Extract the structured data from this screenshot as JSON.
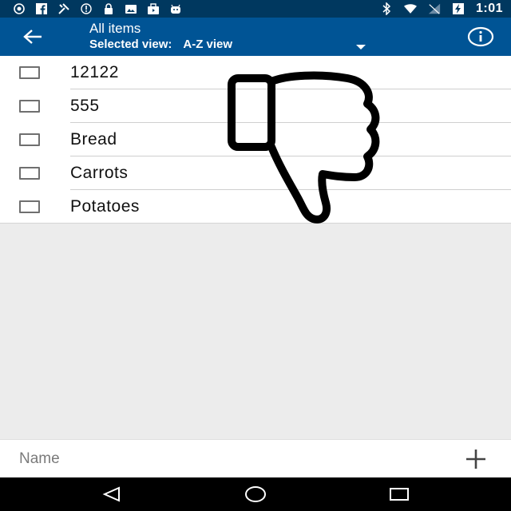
{
  "status_bar": {
    "time": "1:01",
    "icons": [
      "weather-icon",
      "facebook-icon",
      "tools-icon",
      "sync-icon",
      "lock-icon",
      "photo-icon",
      "briefcase-icon",
      "android-icon",
      "bluetooth-icon",
      "wifi-icon",
      "signal-icon",
      "battery-charging-icon"
    ]
  },
  "header": {
    "title": "All items",
    "view_label": "Selected view:",
    "view_value": "A-Z view",
    "back_icon": "arrow-left-icon",
    "info_icon": "info-icon"
  },
  "list": {
    "items": [
      {
        "label": "12122",
        "checked": false
      },
      {
        "label": "555",
        "checked": false
      },
      {
        "label": "Bread",
        "checked": false
      },
      {
        "label": "Carrots",
        "checked": false
      },
      {
        "label": "Potatoes",
        "checked": false
      }
    ]
  },
  "overlay": {
    "icon": "thumbs-down-icon"
  },
  "input_bar": {
    "placeholder": "Name",
    "value": "",
    "add_icon": "plus-icon"
  },
  "nav_bar": {
    "icons": [
      "back-triangle-icon",
      "home-circle-icon",
      "recents-square-icon"
    ]
  },
  "colors": {
    "status_bar": "#00385f",
    "app_bar": "#005495",
    "list_bg": "#ffffff",
    "empty_bg": "#ececec",
    "nav_bar": "#000000"
  }
}
